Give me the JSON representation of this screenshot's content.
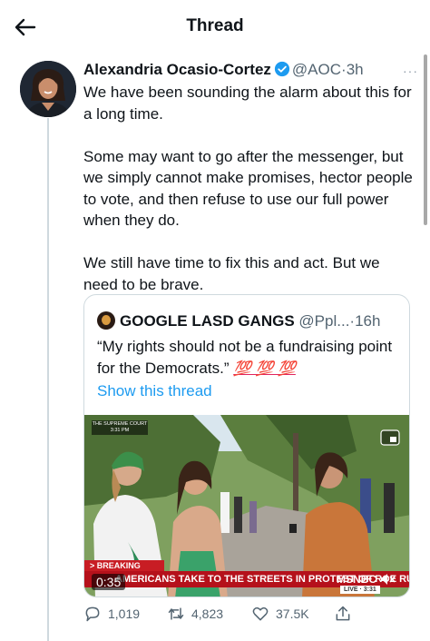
{
  "header": {
    "title": "Thread"
  },
  "tweet": {
    "author_name": "Alexandria Ocasio-Cortez",
    "handle": "@AOC",
    "separator": "·",
    "time": "3h",
    "more": "···",
    "paragraphs": [
      "We have been sounding the alarm about this for a long time.",
      "Some may want to go after the messenger, but we simply cannot make promises, hector people to vote, and then refuse to use our full power when they do.",
      "We still have time to fix this and act. But we need to be brave."
    ],
    "reply_count": "1,019",
    "retweet_count": "4,823",
    "like_count": "37.5K"
  },
  "quote": {
    "author_name": "GOOGLE LASD GANGS",
    "handle": "@Ppl...",
    "separator": "·",
    "time": "16h",
    "text": "“My rights should not be a fundraising point for the Democrats.”",
    "emoji": "💯 💯 💯",
    "show_thread": "Show this thread",
    "media": {
      "chyron_top": "THE SUPREME COURT 3:31 PM",
      "breaking": "> BREAKING NEWS",
      "headline": "AMERICANS TAKE TO THE STREETS IN PROTEST OF ROE RULING",
      "duration": "0:35",
      "network": "MSNBC",
      "live": "LIVE · 3:31"
    }
  },
  "colors": {
    "accent": "#1d9bf0",
    "text_secondary": "#536471",
    "border": "#cfd9de",
    "breaking_red": "#b5111b"
  }
}
